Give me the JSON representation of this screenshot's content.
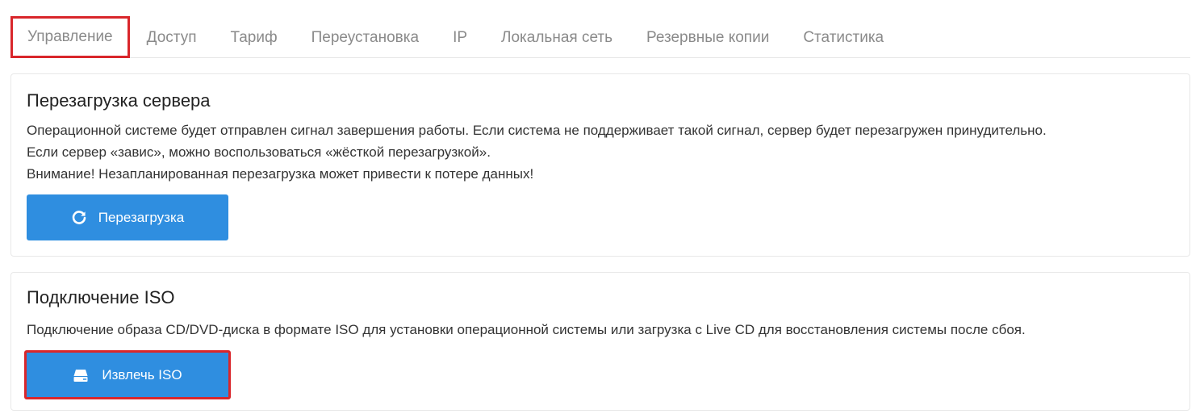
{
  "tabs": [
    {
      "label": "Управление",
      "active": true
    },
    {
      "label": "Доступ"
    },
    {
      "label": "Тариф"
    },
    {
      "label": "Переустановка"
    },
    {
      "label": "IP"
    },
    {
      "label": "Локальная сеть"
    },
    {
      "label": "Резервные копии"
    },
    {
      "label": "Статистика"
    }
  ],
  "reboot": {
    "title": "Перезагрузка сервера",
    "lines": [
      "Операционной системе будет отправлен сигнал завершения работы. Если система не поддерживает такой сигнал, сервер будет перезагружен принудительно.",
      "Если сервер «завис», можно воспользоваться «жёсткой перезагрузкой».",
      "Внимание! Незапланированная перезагрузка может привести к потере данных!"
    ],
    "button_label": "Перезагрузка",
    "button_icon": "refresh-icon"
  },
  "iso": {
    "title": "Подключение ISO",
    "description": "Подключение образа CD/DVD-диска в формате ISO для установки операционной системы или загрузка с Live CD для восстановления системы после сбоя.",
    "button_label": "Извлечь ISO",
    "button_icon": "drive-icon"
  },
  "colors": {
    "accent": "#2f8ee0",
    "highlight": "#d9262b",
    "tab_text": "#8a8a8a"
  }
}
